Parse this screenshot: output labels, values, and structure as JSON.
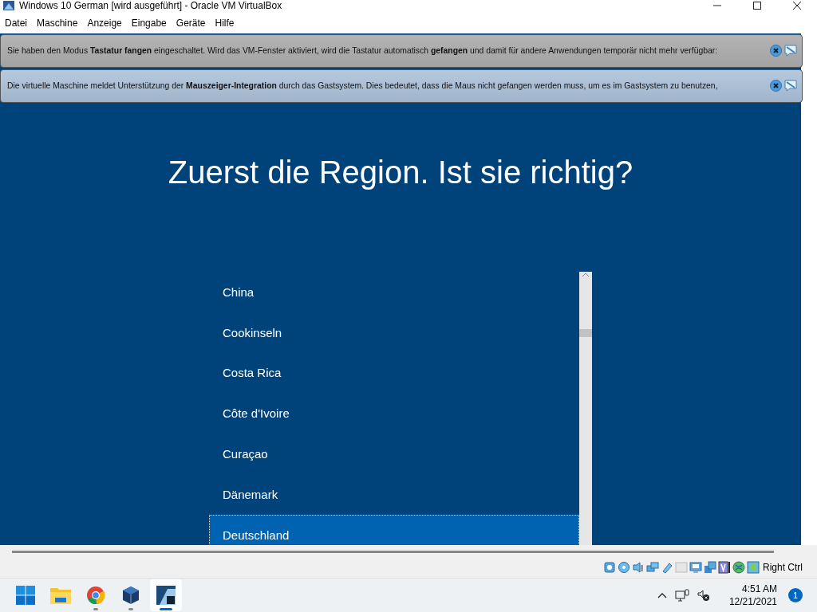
{
  "window": {
    "title": "Windows 10 German [wird ausgeführt] - Oracle VM VirtualBox"
  },
  "menu": [
    "Datei",
    "Maschine",
    "Anzeige",
    "Eingabe",
    "Geräte",
    "Hilfe"
  ],
  "notifications": [
    {
      "kind": "keyboard",
      "text": "Sie haben den Modus **Tastatur fangen** eingeschaltet. Wird das VM-Fenster aktiviert, wird die Tastatur automatisch **gefangen** und damit für andere Anwendungen temporär nicht mehr verfügbar:"
    },
    {
      "kind": "mouse",
      "text": "Die virtuelle Maschine meldet Unterstützung der **Mauszeiger-Integration** durch das Gastsystem. Dies bedeutet, dass die Maus nicht gefangen werden muss, um es im Gastsystem zu benutzen,"
    }
  ],
  "setup": {
    "heading": "Zuerst die Region. Ist sie richtig?",
    "regions": [
      {
        "label": "China",
        "selected": false
      },
      {
        "label": "Cookinseln",
        "selected": false
      },
      {
        "label": "Costa Rica",
        "selected": false
      },
      {
        "label": "Côte d'Ivoire",
        "selected": false
      },
      {
        "label": "Curaçao",
        "selected": false
      },
      {
        "label": "Dänemark",
        "selected": false
      },
      {
        "label": "Deutschland",
        "selected": true
      }
    ]
  },
  "status_bar": {
    "host_key": "Right Ctrl"
  },
  "taskbar": {
    "apps": [
      {
        "kind": "start",
        "running": false,
        "active": false
      },
      {
        "kind": "folder",
        "running": false,
        "active": false
      },
      {
        "kind": "browser",
        "running": true,
        "active": false
      },
      {
        "kind": "cube",
        "running": true,
        "active": false
      },
      {
        "kind": "app",
        "running": true,
        "active": true
      }
    ],
    "time": "4:51 AM",
    "date": "12/21/2021",
    "notification_count": "1"
  }
}
